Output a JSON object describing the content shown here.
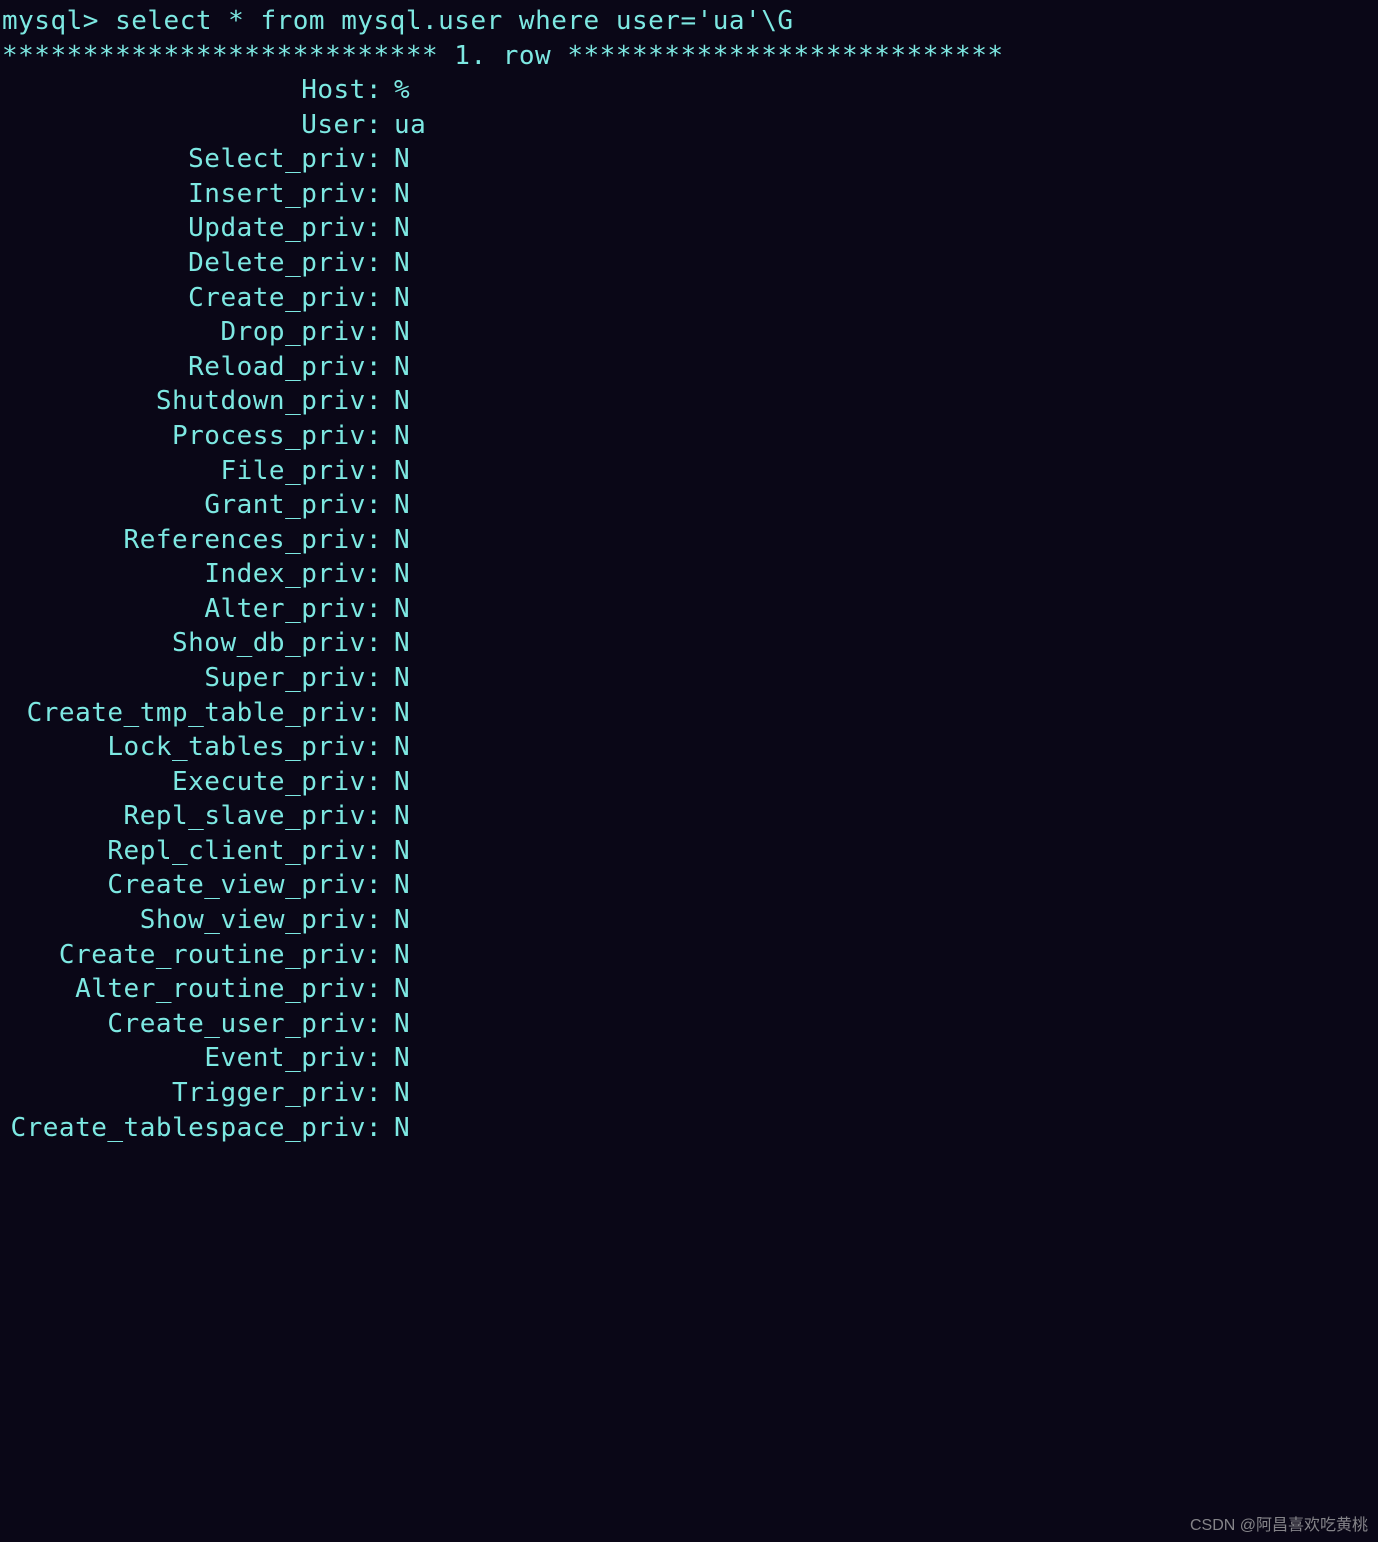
{
  "prompt": "mysql> ",
  "command": "select * from mysql.user where user='ua'\\G",
  "row_separator": "*************************** 1. row ***************************",
  "fields": [
    {
      "name": "Host",
      "value": "%"
    },
    {
      "name": "User",
      "value": "ua"
    },
    {
      "name": "Select_priv",
      "value": "N"
    },
    {
      "name": "Insert_priv",
      "value": "N"
    },
    {
      "name": "Update_priv",
      "value": "N"
    },
    {
      "name": "Delete_priv",
      "value": "N"
    },
    {
      "name": "Create_priv",
      "value": "N"
    },
    {
      "name": "Drop_priv",
      "value": "N"
    },
    {
      "name": "Reload_priv",
      "value": "N"
    },
    {
      "name": "Shutdown_priv",
      "value": "N"
    },
    {
      "name": "Process_priv",
      "value": "N"
    },
    {
      "name": "File_priv",
      "value": "N"
    },
    {
      "name": "Grant_priv",
      "value": "N"
    },
    {
      "name": "References_priv",
      "value": "N"
    },
    {
      "name": "Index_priv",
      "value": "N"
    },
    {
      "name": "Alter_priv",
      "value": "N"
    },
    {
      "name": "Show_db_priv",
      "value": "N"
    },
    {
      "name": "Super_priv",
      "value": "N"
    },
    {
      "name": "Create_tmp_table_priv",
      "value": "N"
    },
    {
      "name": "Lock_tables_priv",
      "value": "N"
    },
    {
      "name": "Execute_priv",
      "value": "N"
    },
    {
      "name": "Repl_slave_priv",
      "value": "N"
    },
    {
      "name": "Repl_client_priv",
      "value": "N"
    },
    {
      "name": "Create_view_priv",
      "value": "N"
    },
    {
      "name": "Show_view_priv",
      "value": "N"
    },
    {
      "name": "Create_routine_priv",
      "value": "N"
    },
    {
      "name": "Alter_routine_priv",
      "value": "N"
    },
    {
      "name": "Create_user_priv",
      "value": "N"
    },
    {
      "name": "Event_priv",
      "value": "N"
    },
    {
      "name": "Trigger_priv",
      "value": "N"
    },
    {
      "name": "Create_tablespace_priv",
      "value": "N"
    }
  ],
  "watermark": "CSDN @阿昌喜欢吃黄桃"
}
